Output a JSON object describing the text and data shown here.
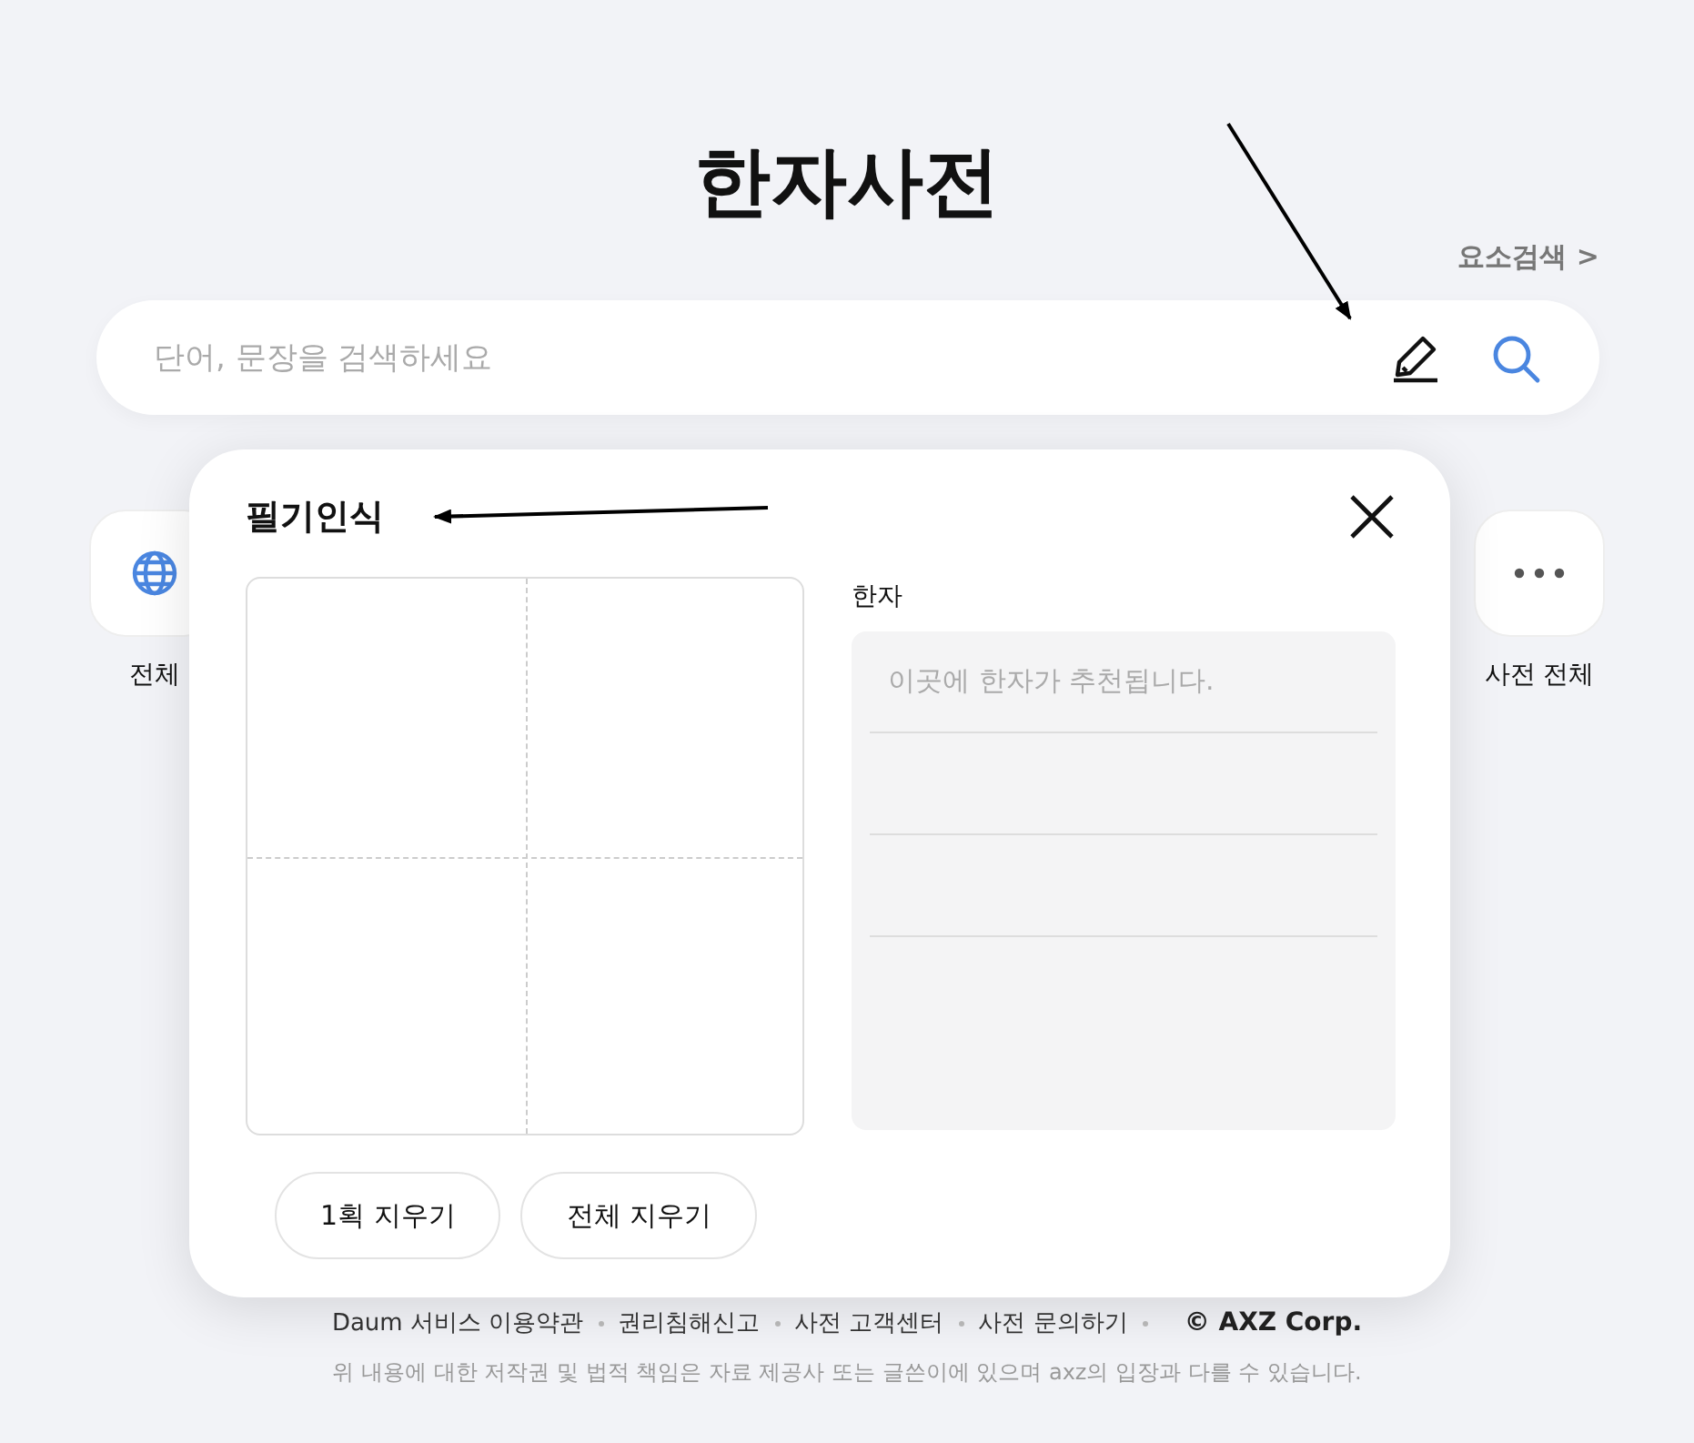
{
  "title": "한자사전",
  "element_search_link": "요소검색 >",
  "search": {
    "placeholder": "단어, 문장을 검색하세요"
  },
  "categories": [
    {
      "kind": "globe",
      "label": "전체"
    },
    {
      "kind": "more",
      "label": "사전 전체"
    }
  ],
  "handwriting_popup": {
    "title": "필기인식",
    "result_label": "한자",
    "result_placeholder": "이곳에 한자가 추천됩니다.",
    "buttons": [
      "1획 지우기",
      "전체 지우기"
    ]
  },
  "footer": {
    "links": [
      "Daum 서비스 이용약관",
      "권리침해신고",
      "사전 고객센터",
      "사전 문의하기"
    ],
    "copyright": "© AXZ Corp.",
    "disclaimer": "위 내용에 대한 저작권 및 법적 책임은 자료 제공사 또는 글쓴이에 있으며 axz의 입장과 다를 수 있습니다."
  }
}
